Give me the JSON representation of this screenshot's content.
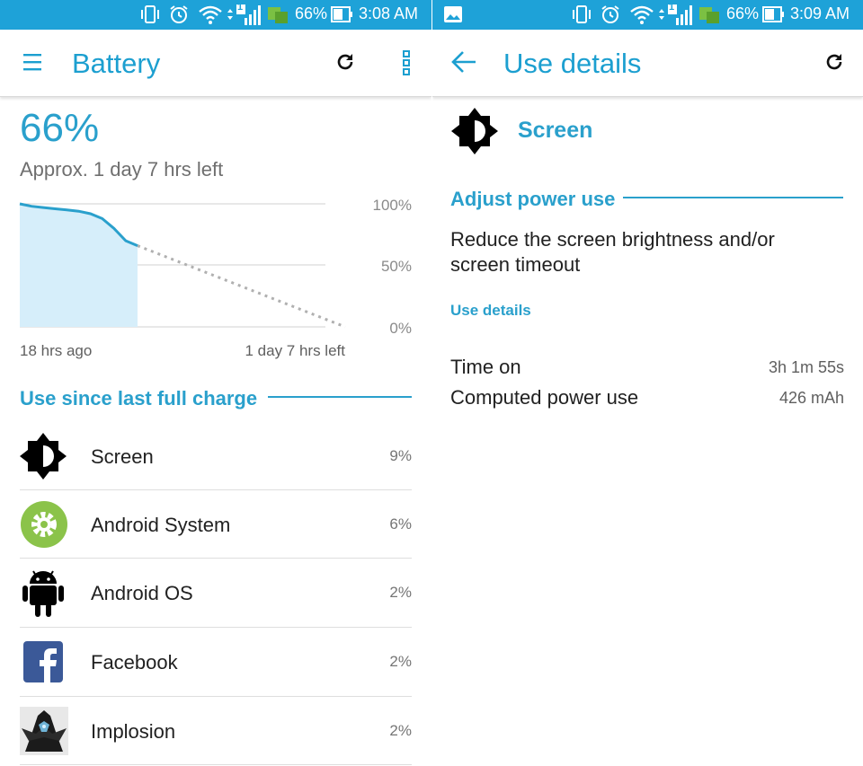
{
  "left": {
    "status": {
      "battery_pct": "66%",
      "time": "3:08 AM",
      "sim_badge": "1"
    },
    "appbar": {
      "menu_icon": "hamburger-menu-icon",
      "title": "Battery",
      "refresh_icon": "refresh-icon",
      "overflow_icon": "overflow-menu-icon"
    },
    "summary": {
      "percent": "66%",
      "estimate": "Approx. 1 day 7 hrs left"
    },
    "chart_labels": {
      "y_top": "100%",
      "y_mid": "50%",
      "y_bottom": "0%",
      "x_start": "18 hrs ago",
      "x_end": "1 day 7 hrs left"
    },
    "section_title": "Use since last full charge",
    "apps": [
      {
        "name": "Screen",
        "pct": "9%",
        "icon": "screen-brightness-icon"
      },
      {
        "name": "Android System",
        "pct": "6%",
        "icon": "android-system-gear-icon"
      },
      {
        "name": "Android OS",
        "pct": "2%",
        "icon": "android-robot-icon"
      },
      {
        "name": "Facebook",
        "pct": "2%",
        "icon": "facebook-icon"
      },
      {
        "name": "Implosion",
        "pct": "2%",
        "icon": "implosion-game-icon"
      }
    ]
  },
  "right": {
    "status": {
      "battery_pct": "66%",
      "time": "3:09 AM",
      "sim_badge": "1"
    },
    "appbar": {
      "back_icon": "back-arrow-icon",
      "title": "Use details",
      "refresh_icon": "refresh-icon"
    },
    "header": {
      "icon": "screen-brightness-icon",
      "title": "Screen"
    },
    "adjust_title": "Adjust power use",
    "adjust_text": "Reduce the screen brightness and/or screen timeout",
    "details_title": "Use details",
    "details": [
      {
        "label": "Time on",
        "value": "3h 1m 55s"
      },
      {
        "label": "Computed power use",
        "value": "426 mAh"
      }
    ]
  },
  "chart_data": {
    "type": "area",
    "x_labels": [
      "18 hrs ago",
      "1 day 7 hrs left"
    ],
    "y_ticks": [
      "0%",
      "50%",
      "100%"
    ],
    "ylim": [
      0,
      100
    ],
    "series": [
      {
        "values": [
          100,
          98,
          97,
          96,
          95,
          94,
          92,
          88,
          80,
          70,
          66
        ]
      }
    ],
    "projection": {
      "from": 66,
      "to": 0
    },
    "colors": {
      "line": "#2aa0cc",
      "fill": "#d6eefa",
      "projection": "#b0b0b0"
    }
  },
  "theme": {
    "accent": "#2aa0cc",
    "statusbar": "#1ea2d8"
  }
}
